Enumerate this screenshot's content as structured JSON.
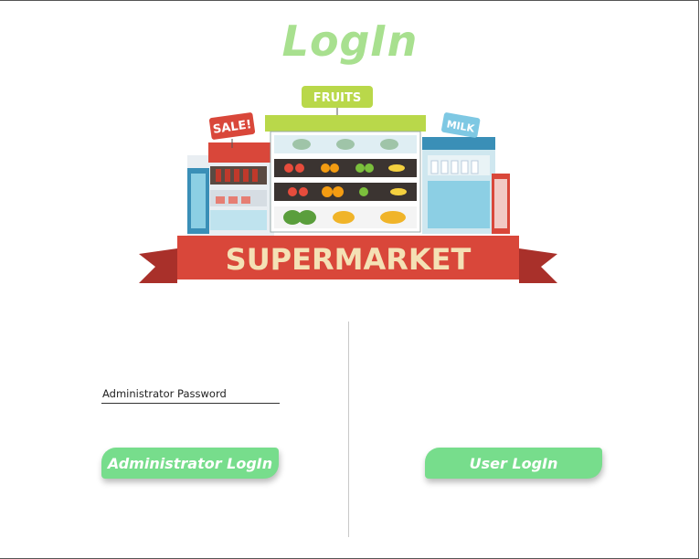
{
  "window": {
    "title": "LogIn"
  },
  "banner": {
    "sign_sale": "SALE!",
    "sign_fruits": "FRUITS",
    "sign_milk": "MILK",
    "ribbon": "SUPERMARKET"
  },
  "admin": {
    "password_placeholder": "Administrator Password",
    "password_value": "",
    "login_label": "Administrator LogIn"
  },
  "user": {
    "login_label": "User LogIn"
  },
  "colors": {
    "accent": "#77dd8c",
    "title": "#a8e08f",
    "ribbon": "#d9473a",
    "ribbon_text": "#f4e1b5"
  }
}
